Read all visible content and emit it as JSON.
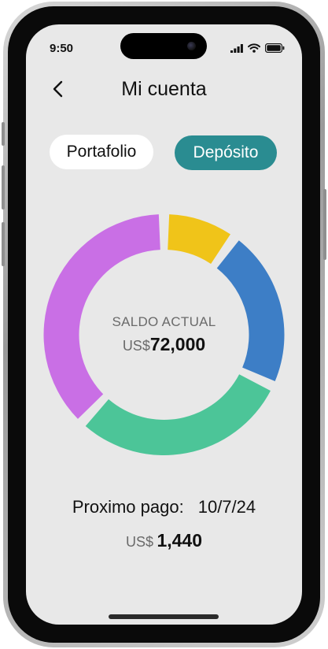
{
  "status_bar": {
    "time": "9:50",
    "icons": [
      "signal-icon",
      "wifi-icon",
      "battery-icon"
    ]
  },
  "header": {
    "title": "Mi cuenta",
    "back_icon": "chevron-left-icon"
  },
  "tabs": {
    "portfolio_label": "Portafolio",
    "deposit_label": "Depósito",
    "active": "Depósito"
  },
  "colors": {
    "screen_bg": "#e8e8e8",
    "accent": "#2a8c91",
    "segment_yellow": "#f0c419",
    "segment_blue": "#3d7ec6",
    "segment_green": "#4cc598",
    "segment_purple": "#c96fe5"
  },
  "balance": {
    "label": "SALDO ACTUAL",
    "currency": "US$",
    "amount": "72,000"
  },
  "chart_data": {
    "type": "pie",
    "variant": "donut",
    "categories": [
      "",
      "",
      "",
      ""
    ],
    "values": [
      10,
      22,
      30,
      38
    ],
    "colors": [
      "#f0c419",
      "#3d7ec6",
      "#4cc598",
      "#c96fe5"
    ],
    "start_angle_deg": 0,
    "title": "",
    "legend": "none"
  },
  "payment": {
    "label": "Proximo pago:",
    "date": "10/7/24",
    "currency": "US$",
    "amount": "1,440"
  }
}
